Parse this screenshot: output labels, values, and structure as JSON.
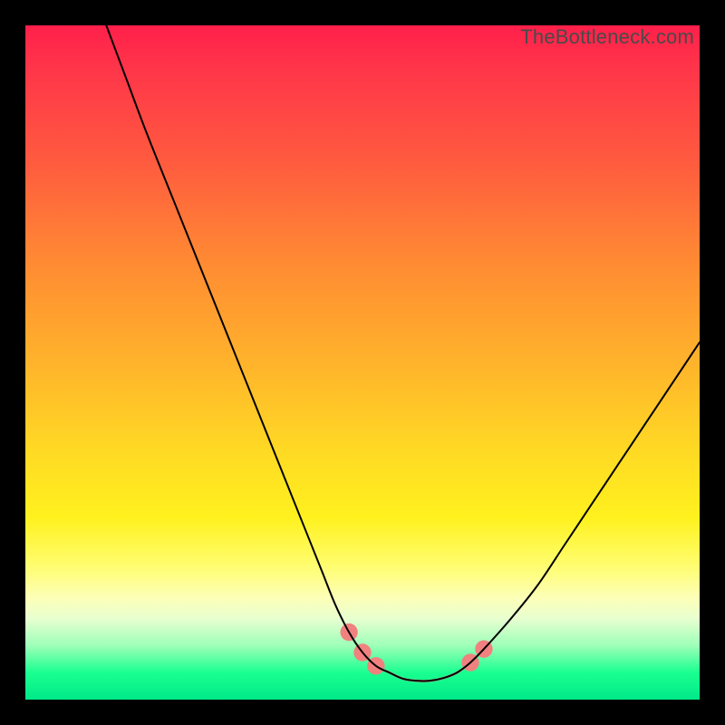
{
  "watermark": "TheBottleneck.com",
  "chart_data": {
    "type": "line",
    "title": "",
    "xlabel": "",
    "ylabel": "",
    "xlim": [
      0,
      100
    ],
    "ylim": [
      0,
      100
    ],
    "highlight_threshold_y": 8,
    "highlight_color": "#f1817f",
    "series": [
      {
        "name": "left-branch",
        "x": [
          12,
          15,
          18,
          22,
          26,
          30,
          34,
          38,
          42,
          44,
          46,
          48,
          50,
          52,
          54
        ],
        "y": [
          100,
          92,
          84,
          74,
          64,
          54,
          44,
          34,
          24,
          19,
          14,
          10,
          7,
          5,
          4
        ]
      },
      {
        "name": "valley",
        "x": [
          54,
          56,
          58,
          60,
          62,
          64
        ],
        "y": [
          4,
          3.1,
          2.8,
          2.8,
          3.2,
          4
        ]
      },
      {
        "name": "right-branch",
        "x": [
          64,
          66,
          68,
          72,
          76,
          80,
          84,
          88,
          92,
          96,
          100
        ],
        "y": [
          4,
          5.5,
          7.5,
          12,
          17,
          23,
          29,
          35,
          41,
          47,
          53
        ]
      }
    ]
  }
}
